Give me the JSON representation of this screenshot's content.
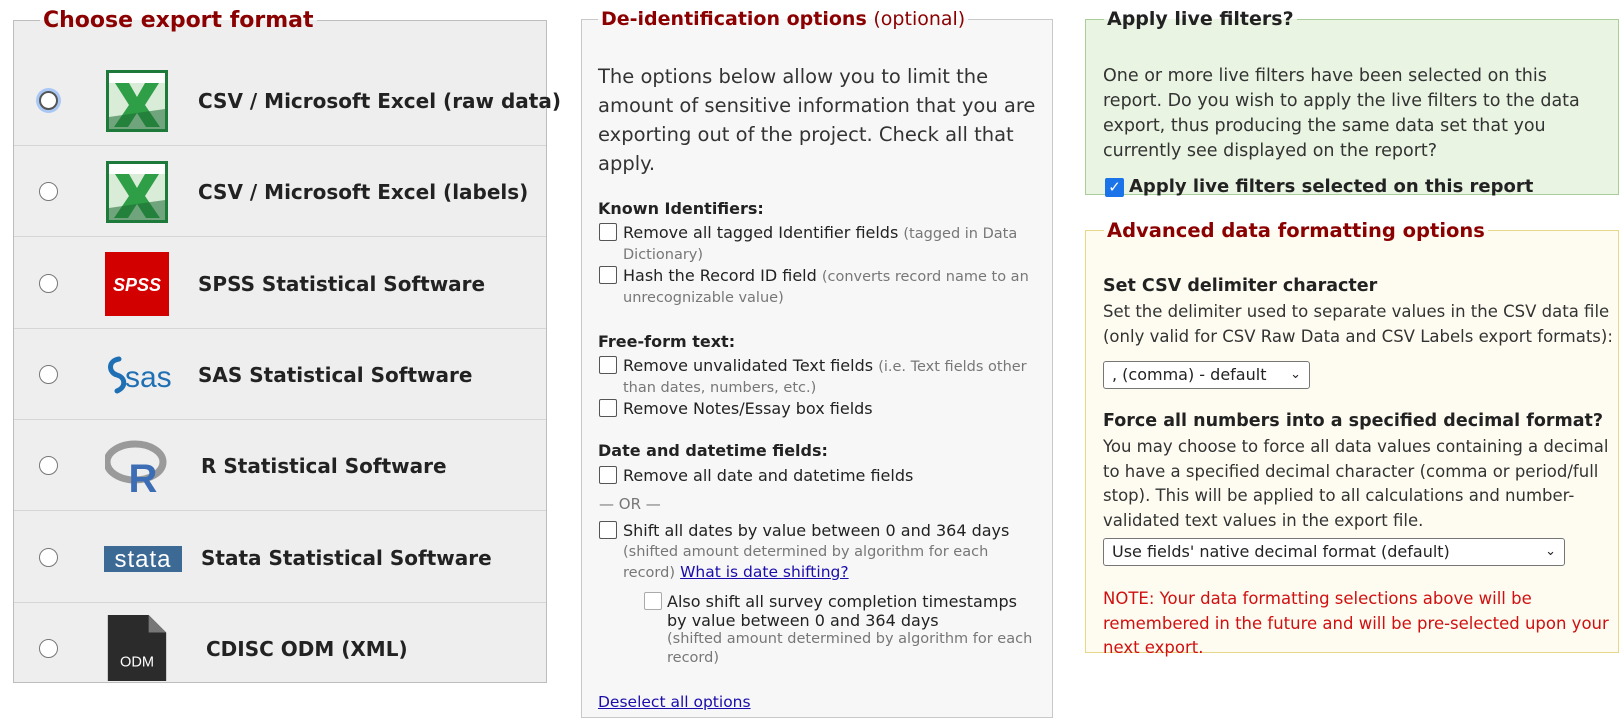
{
  "export_format": {
    "legend": "Choose export format",
    "options": [
      {
        "label": "CSV / Microsoft Excel (raw data)",
        "icon": "excel-icon",
        "focused": true
      },
      {
        "label": "CSV / Microsoft Excel (labels)",
        "icon": "excel-icon",
        "focused": false
      },
      {
        "label": "SPSS Statistical Software",
        "icon": "spss-icon",
        "focused": false
      },
      {
        "label": "SAS Statistical Software",
        "icon": "sas-icon",
        "focused": false
      },
      {
        "label": "R Statistical Software",
        "icon": "r-icon",
        "focused": false
      },
      {
        "label": "Stata Statistical Software",
        "icon": "stata-icon",
        "focused": false
      },
      {
        "label": "CDISC ODM (XML)",
        "icon": "odm-file-icon",
        "focused": false
      }
    ],
    "icon_texts": {
      "spss": "SPSS",
      "sas": "sas",
      "r": "R",
      "stata": "stata",
      "odm": "ODM"
    }
  },
  "deid": {
    "legend": "De-identification options",
    "legend_optional": "(optional)",
    "intro": "The options below allow you to limit the amount of sensitive information that you are exporting out of the project. Check all that apply.",
    "known_identifiers": {
      "heading": "Known Identifiers:",
      "remove_identifiers": {
        "label": "Remove all tagged Identifier fields",
        "note": "(tagged in Data Dictionary)"
      },
      "hash_record_id": {
        "label": "Hash the Record ID field",
        "note": "(converts record name to an unrecognizable value)"
      }
    },
    "free_form": {
      "heading": "Free-form text:",
      "remove_text": {
        "label": "Remove unvalidated Text fields",
        "note": "(i.e. Text fields other than dates, numbers, etc.)"
      },
      "remove_notes": {
        "label": "Remove Notes/Essay box fields"
      }
    },
    "dates": {
      "heading": "Date and datetime fields:",
      "remove_dates": {
        "label": "Remove all date and datetime fields"
      },
      "or_text": "— OR —",
      "shift_dates": {
        "label": "Shift all dates by value between 0 and 364 days",
        "note": "(shifted amount determined by algorithm for each record)",
        "link": "What is date shifting?"
      },
      "shift_survey": {
        "label_line1": "Also shift all survey completion timestamps",
        "label_line2": "by value between 0 and 364 days",
        "note": "(shifted amount determined by algorithm for each record)"
      }
    },
    "deselect_link": "Deselect all options"
  },
  "live_filters": {
    "legend": "Apply live filters?",
    "text": "One or more live filters have been selected on this report. Do you wish to apply the live filters to the data export, thus producing the same data set that you currently see displayed on the report?",
    "checkbox_label": "Apply live filters selected on this report",
    "checked": true,
    "check_glyph": "✓"
  },
  "advanced": {
    "legend": "Advanced data formatting options",
    "delimiter": {
      "heading": "Set CSV delimiter character",
      "text": "Set the delimiter used to separate values in the CSV data file (only valid for CSV Raw Data and CSV Labels export formats):",
      "selected": ", (comma) - default",
      "chevron": "⌄"
    },
    "decimal": {
      "heading": "Force all numbers into a specified decimal format?",
      "text": "You may choose to force all data values containing a decimal to have a specified decimal character (comma or period/full stop). This will be applied to all calculations and number-validated text values in the export file.",
      "selected": "Use fields' native decimal format (default)",
      "chevron": "⌄"
    },
    "note": "NOTE: Your data formatting selections above will be remembered in the future and will be pre-selected upon your next export."
  }
}
